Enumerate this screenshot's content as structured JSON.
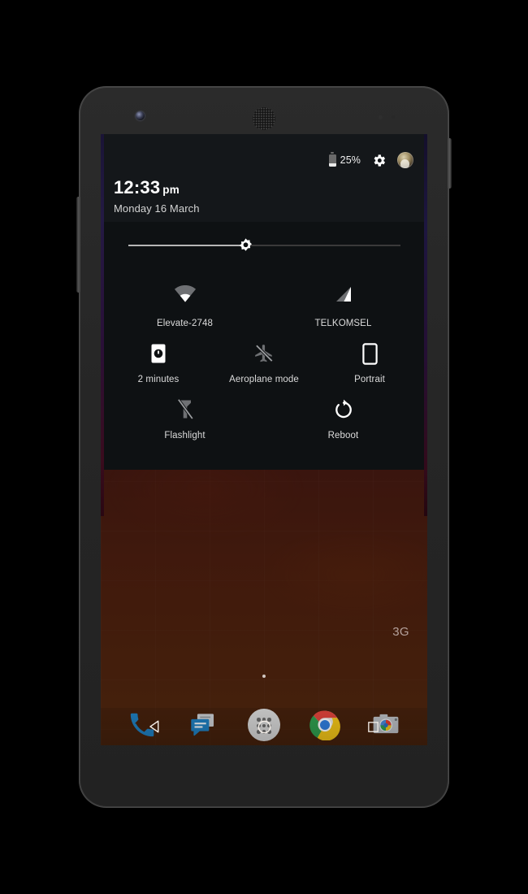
{
  "device": {
    "name": "android-phone",
    "front_camera": "front-camera",
    "earpiece": "earpiece-speaker",
    "volume_rocker": "volume-rocker",
    "power_button": "power-button"
  },
  "status_bar": {
    "battery_percent": "25%",
    "battery_icon": "battery-icon",
    "settings_icon": "gear-icon",
    "avatar_icon": "user-avatar"
  },
  "shade": {
    "time": "12:33",
    "time_meridiem": "pm",
    "date": "Monday 16 March",
    "brightness": {
      "label": "brightness-slider",
      "value_percent": 43,
      "icon": "brightness-sun-icon"
    },
    "tiles": [
      [
        {
          "label": "Elevate-2748",
          "icon": "wifi-icon",
          "name": "tile-wifi"
        },
        {
          "label": "TELKOMSEL",
          "icon": "cellular-signal-icon",
          "name": "tile-cellular"
        }
      ],
      [
        {
          "label": "2 minutes",
          "icon": "screen-timeout-icon",
          "name": "tile-screen-timeout"
        },
        {
          "label": "Aeroplane mode",
          "icon": "airplane-off-icon",
          "name": "tile-aeroplane-mode"
        },
        {
          "label": "Portrait",
          "icon": "rotation-portrait-icon",
          "name": "tile-rotation"
        }
      ],
      [
        {
          "label": "Flashlight",
          "icon": "flashlight-off-icon",
          "name": "tile-flashlight"
        },
        {
          "label": "Reboot",
          "icon": "reboot-icon",
          "name": "tile-reboot"
        }
      ]
    ]
  },
  "homescreen": {
    "network_badge": "3G",
    "page_indicator": "page-dot",
    "dock": [
      {
        "name": "dock-phone",
        "icon": "phone-icon",
        "label": "Phone"
      },
      {
        "name": "dock-messaging",
        "icon": "messaging-icon",
        "label": "Messenger"
      },
      {
        "name": "dock-app-drawer",
        "icon": "app-drawer-icon",
        "label": "Apps"
      },
      {
        "name": "dock-chrome",
        "icon": "chrome-icon",
        "label": "Chrome"
      },
      {
        "name": "dock-camera",
        "icon": "camera-icon",
        "label": "Camera"
      }
    ]
  },
  "navbar": {
    "back": "back-icon",
    "home": "home-icon",
    "recents": "recents-icon"
  },
  "colors": {
    "shade_bg": "#0e1113",
    "shade_header_bg": "#14171a",
    "tile_label": "#dcdcdc",
    "accent_white": "#ffffff",
    "wallpaper_base": "#3a1220"
  }
}
